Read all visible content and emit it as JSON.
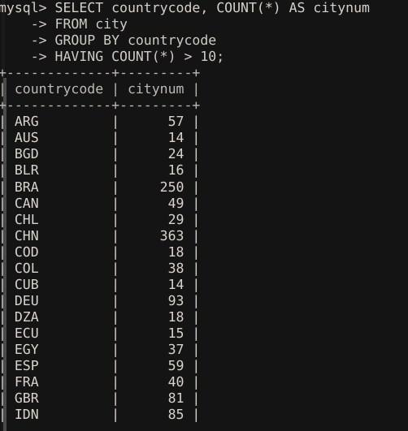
{
  "terminal": {
    "app": "mysql-client",
    "background_color": "#141414",
    "foreground_color": "#d5d0c8",
    "prompt": "mysql> ",
    "continuation_prompt": "    -> "
  },
  "scrollbar": {
    "name": "vertical-scrollbar",
    "orientation": "vertical",
    "position": "left",
    "track_color": "#1b1b1b",
    "thumb_color": "#4a4a4a"
  },
  "query": {
    "lines": [
      "mysql> SELECT countrycode, COUNT(*) AS citynum",
      "    -> FROM city",
      "    -> GROUP BY countrycode",
      "    -> HAVING COUNT(*) > 10;"
    ],
    "statement": "SELECT countrycode, COUNT(*) AS citynum FROM city GROUP BY countrycode HAVING COUNT(*) > 10;"
  },
  "result_table": {
    "separator": "+-------------+---------+",
    "header_row": "| countrycode | citynum |",
    "columns": [
      "countrycode",
      "citynum"
    ],
    "rows": [
      [
        "ARG",
        "57"
      ],
      [
        "AUS",
        "14"
      ],
      [
        "BGD",
        "24"
      ],
      [
        "BLR",
        "16"
      ],
      [
        "BRA",
        "250"
      ],
      [
        "CAN",
        "49"
      ],
      [
        "CHL",
        "29"
      ],
      [
        "CHN",
        "363"
      ],
      [
        "COD",
        "18"
      ],
      [
        "COL",
        "38"
      ],
      [
        "CUB",
        "14"
      ],
      [
        "DEU",
        "93"
      ],
      [
        "DZA",
        "18"
      ],
      [
        "ECU",
        "15"
      ],
      [
        "EGY",
        "37"
      ],
      [
        "ESP",
        "59"
      ],
      [
        "FRA",
        "40"
      ],
      [
        "GBR",
        "81"
      ],
      [
        "IDN",
        "85"
      ]
    ]
  }
}
